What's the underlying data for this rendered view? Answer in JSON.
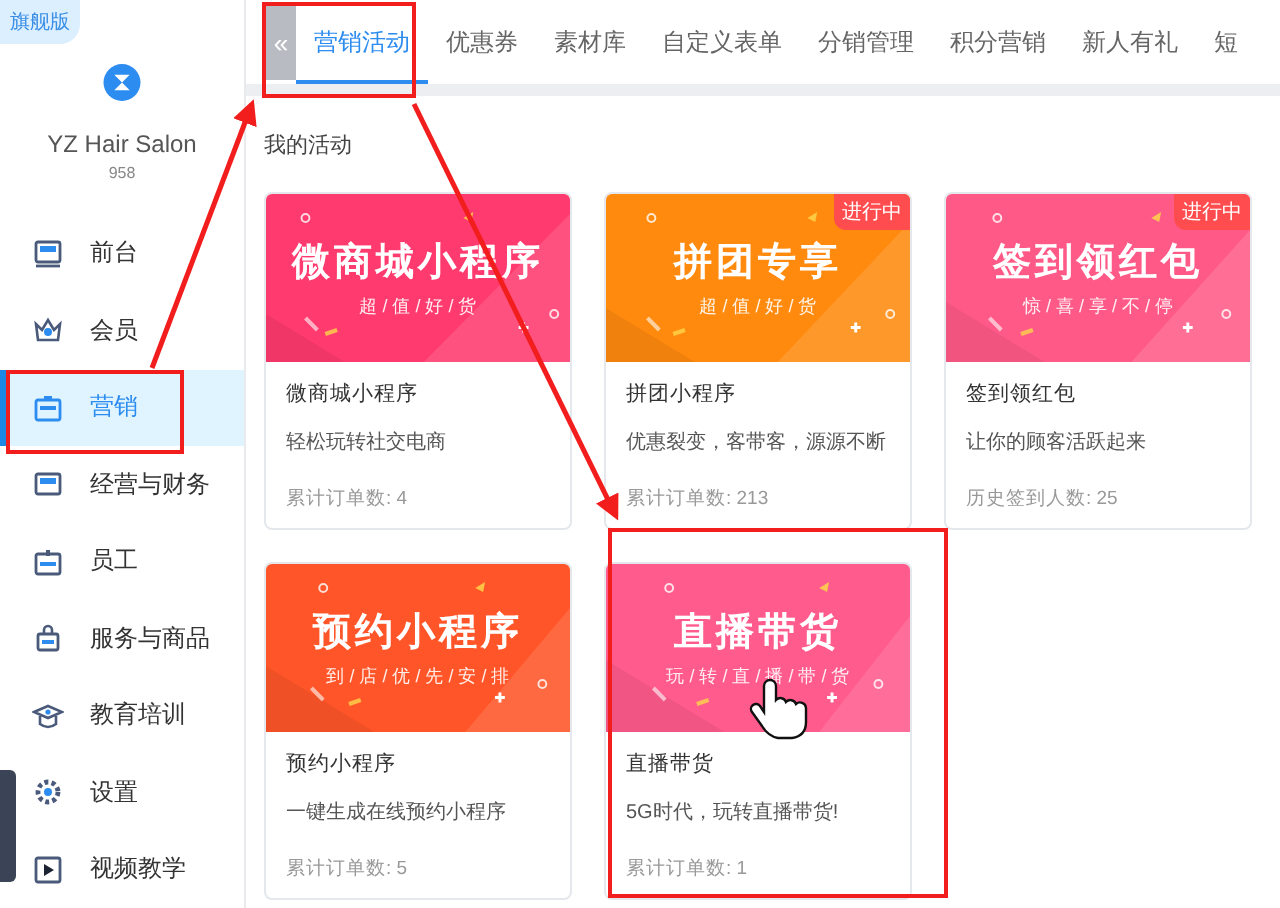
{
  "edition_badge": "旗舰版",
  "store": {
    "name": "YZ Hair Salon",
    "id": "958"
  },
  "sidebar": {
    "items": [
      {
        "label": "前台",
        "selected": false
      },
      {
        "label": "会员",
        "selected": false
      },
      {
        "label": "营销",
        "selected": true
      },
      {
        "label": "经营与财务",
        "selected": false
      },
      {
        "label": "员工",
        "selected": false
      },
      {
        "label": "服务与商品",
        "selected": false
      },
      {
        "label": "教育培训",
        "selected": false
      },
      {
        "label": "设置",
        "selected": false
      },
      {
        "label": "视频教学",
        "selected": false
      }
    ]
  },
  "collapse_button": "«",
  "tabs": [
    {
      "label": "营销活动",
      "selected": true
    },
    {
      "label": "优惠券",
      "selected": false
    },
    {
      "label": "素材库",
      "selected": false
    },
    {
      "label": "自定义表单",
      "selected": false
    },
    {
      "label": "分销管理",
      "selected": false
    },
    {
      "label": "积分营销",
      "selected": false
    },
    {
      "label": "新人有礼",
      "selected": false
    },
    {
      "label": "短",
      "selected": false
    }
  ],
  "section_title": "我的活动",
  "cards": [
    {
      "banner_title": "微商城小程序",
      "banner_subtitle": "超 / 值 / 好 / 货",
      "color": "#ff3a6e",
      "name": "微商城小程序",
      "description": "轻松玩转社交电商",
      "stat": "累计订单数: 4"
    },
    {
      "banner_title": "拼团专享",
      "banner_subtitle": "超 / 值 / 好 / 货",
      "color": "#ff8a0e",
      "badge": "进行中",
      "name": "拼团小程序",
      "description": "优惠裂变，客带客，源源不断",
      "stat": "累计订单数: 213"
    },
    {
      "banner_title": "签到领红包",
      "banner_subtitle": "惊 / 喜 / 享 / 不 / 停",
      "color": "#ff5a87",
      "badge": "进行中",
      "name": "签到领红包",
      "description": "让你的顾客活跃起来",
      "stat": "历史签到人数: 25"
    },
    {
      "banner_title": "预约小程序",
      "banner_subtitle": "到 / 店 / 优 / 先 / 安 / 排",
      "color": "#ff5528",
      "name": "预约小程序",
      "description": "一键生成在线预约小程序",
      "stat": "累计订单数: 5"
    },
    {
      "banner_title": "直播带货",
      "banner_subtitle": "玩 / 转 / 直 / 播 / 带 / 货",
      "color": "#ff5b8c",
      "name": "直播带货",
      "description": "5G时代，玩转直播带货!",
      "stat": "累计订单数: 1"
    }
  ]
}
